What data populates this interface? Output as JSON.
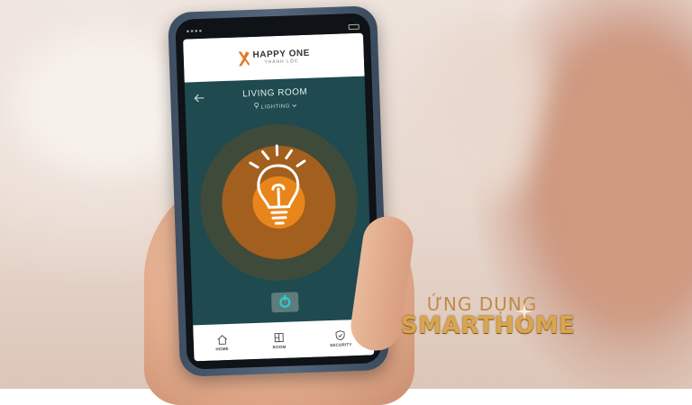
{
  "colors": {
    "screen_bg": "#1e4a50",
    "ring_outer": "#3f4b3a",
    "ring_mid": "#a35f1e",
    "ring_inner": "#e8861c",
    "power_accent": "#27d1d6",
    "caption_gold": "#d9a64f"
  },
  "app": {
    "brand": "HAPPY ONE",
    "brand_sub": "THÀNH LỘC"
  },
  "nav": {
    "back_icon": "arrow-left-icon",
    "room_title": "LIVING ROOM",
    "category": "LIGHTING",
    "category_icon": "bulb-icon",
    "dropdown_icon": "chevron-down-icon"
  },
  "device": {
    "icon": "lightbulb-icon",
    "state": "on",
    "power_icon": "power-icon"
  },
  "tabs": [
    {
      "label": "HOME",
      "icon": "house-icon"
    },
    {
      "label": "ROOM",
      "icon": "room-icon"
    },
    {
      "label": "SECURITY",
      "icon": "shield-icon"
    }
  ],
  "caption": {
    "line1": "ỨNG DỤNG",
    "line2": "SMARTHOME"
  }
}
